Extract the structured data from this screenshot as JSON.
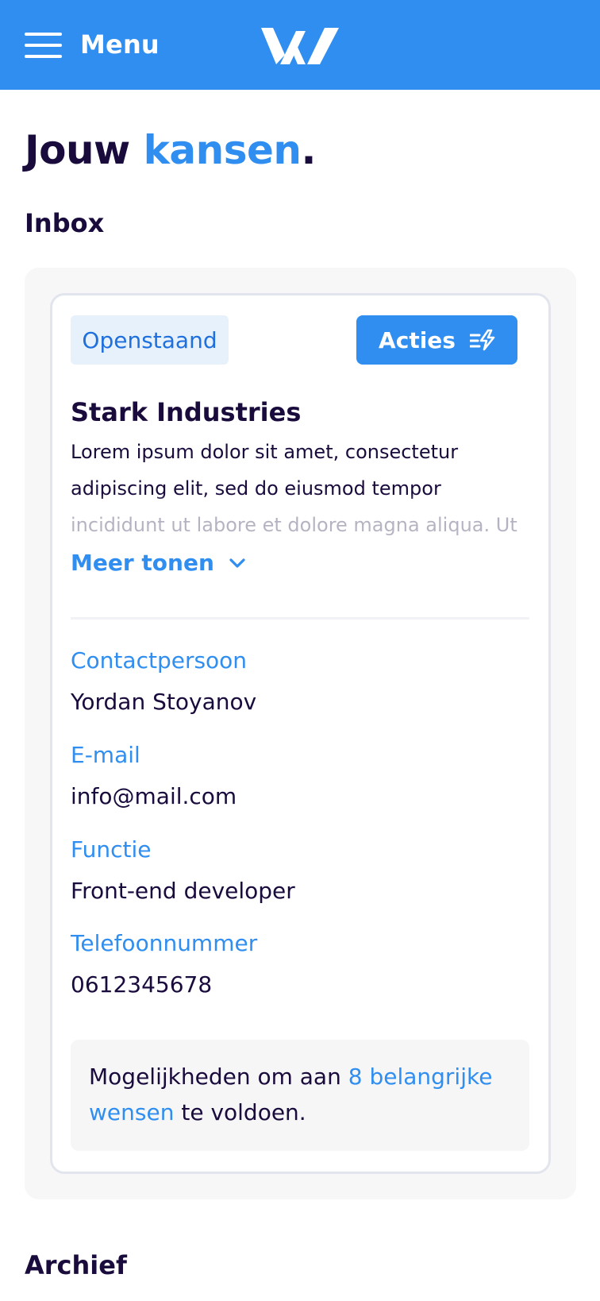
{
  "header": {
    "menu_label": "Menu",
    "logo_icon": "brand-w-logo",
    "background_color": "#2f8eef"
  },
  "page": {
    "title_main": "Jouw ",
    "title_accent": "kansen",
    "title_end": ".",
    "accent_color": "#2f8eef",
    "text_color": "#1a0b3d"
  },
  "inbox": {
    "title": "Inbox",
    "card": {
      "status": "Openstaand",
      "actions_label": "Acties",
      "actions_icon": "lightning-lines-icon",
      "company": "Stark Industries",
      "description": "Lorem ipsum dolor sit amet, consectetur adipiscing elit, sed do eiusmod tempor incididunt ut labore et dolore magna aliqua. Ut",
      "show_more_label": "Meer tonen",
      "fields": {
        "contact": {
          "label": "Contactpersoon",
          "value": "Yordan Stoyanov"
        },
        "email": {
          "label": "E-mail",
          "value": "info@mail.com"
        },
        "function": {
          "label": "Functie",
          "value": "Front-end developer"
        },
        "phone": {
          "label": "Telefoonnummer",
          "value": "0612345678"
        }
      },
      "wishes": {
        "prefix": "Mogelijkheden om aan ",
        "link": "8 belangrijke wensen",
        "suffix": " te voldoen."
      }
    }
  },
  "archive": {
    "title": "Archief"
  }
}
